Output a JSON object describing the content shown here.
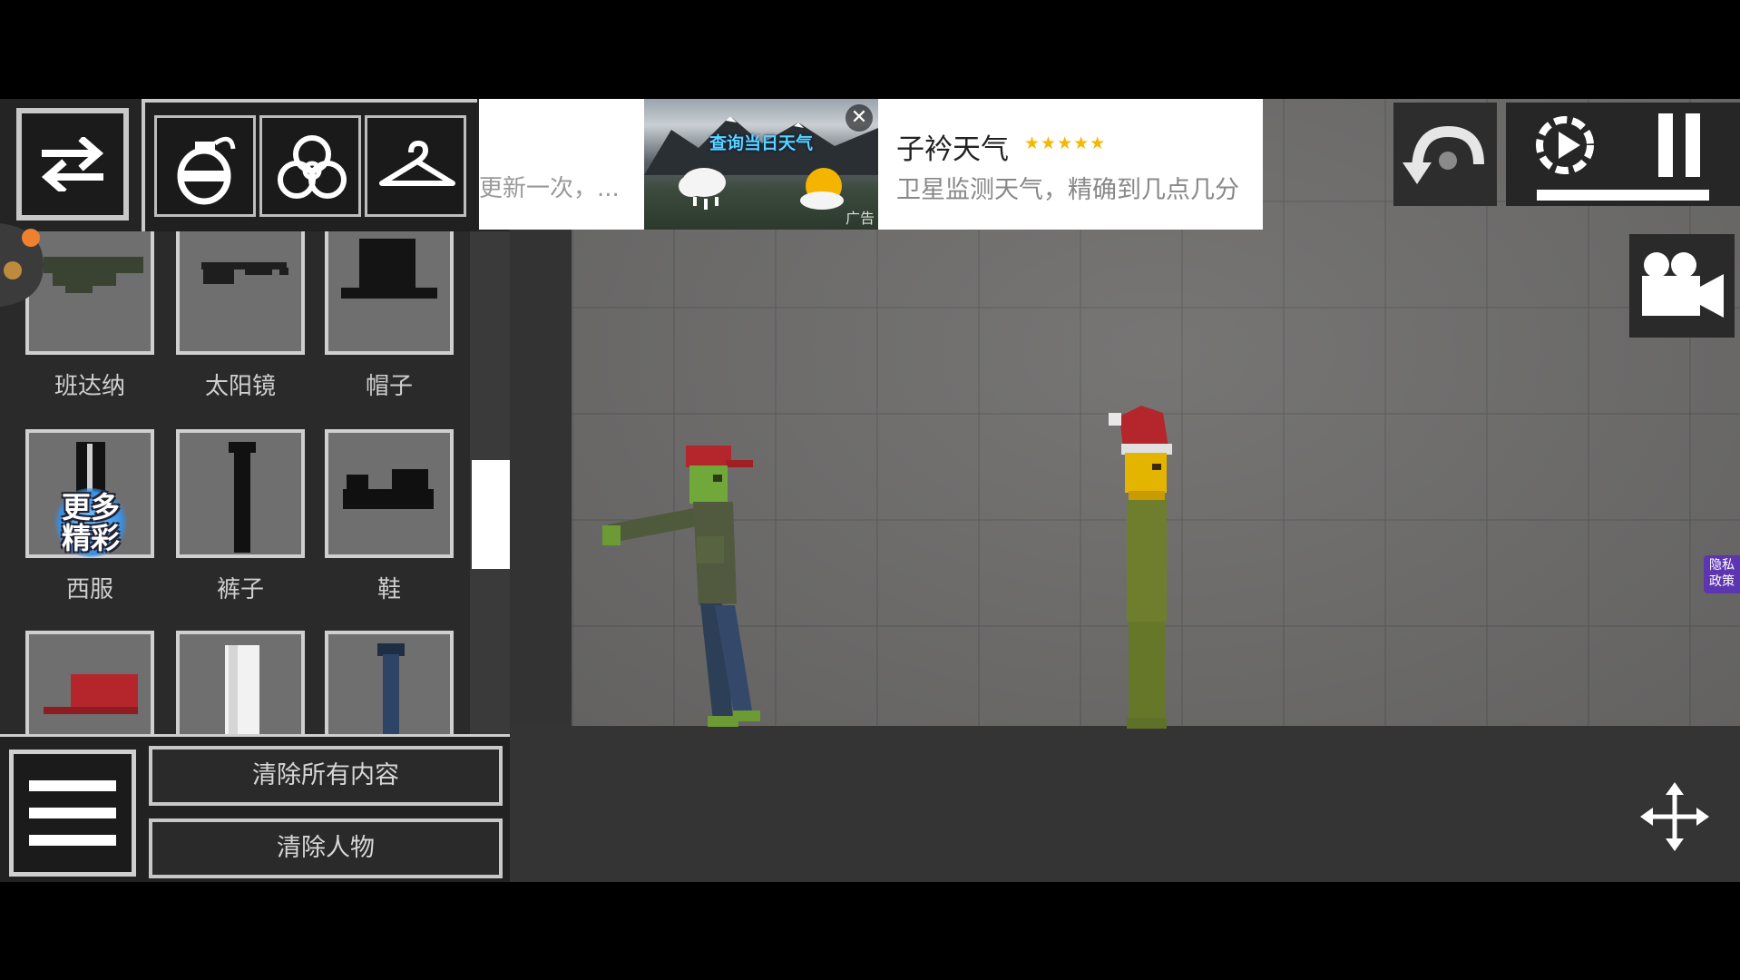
{
  "ad": {
    "left_text": "更新一次，...",
    "image_text": "查询当日天气",
    "tag": "广告",
    "close_label": "✕",
    "title": "子衿天气",
    "stars": "★★★★★",
    "description": "卫星监测天气，精确到几点几分"
  },
  "items": [
    {
      "label": "班达纳",
      "icon": "bandana-icon"
    },
    {
      "label": "太阳镜",
      "icon": "sunglasses-icon"
    },
    {
      "label": "帽子",
      "icon": "hat-icon"
    },
    {
      "label": "西服",
      "icon": "suit-icon"
    },
    {
      "label": "裤子",
      "icon": "pants-icon"
    },
    {
      "label": "鞋",
      "icon": "shoes-icon"
    },
    {
      "label": "",
      "icon": "cap-icon"
    },
    {
      "label": "",
      "icon": "white-shirt-icon"
    },
    {
      "label": "",
      "icon": "jeans-icon"
    }
  ],
  "more_badge": {
    "line1": "更多",
    "line2": "精彩"
  },
  "buttons": {
    "clear_all": "清除所有内容",
    "clear_people": "清除人物"
  },
  "privacy": {
    "line1": "隐私",
    "line2": "政策"
  },
  "slow_motion_fill": 1.0,
  "colors": {
    "panel": "#242424",
    "button_border": "#c8c8c8",
    "room": "#6e6d6c",
    "floor": "#343434",
    "ad_star": "#f5b800",
    "privacy": "#5e35b1"
  },
  "icons": {
    "swap": "swap-arrows-icon",
    "categories": [
      "grenade-icon",
      "biohazard-icon",
      "hanger-icon"
    ],
    "undo": "undo-icon",
    "slowmo": "slow-motion-icon",
    "pause": "pause-icon",
    "camera": "camera-icon",
    "move": "move-arrows-icon",
    "menu": "menu-icon"
  }
}
